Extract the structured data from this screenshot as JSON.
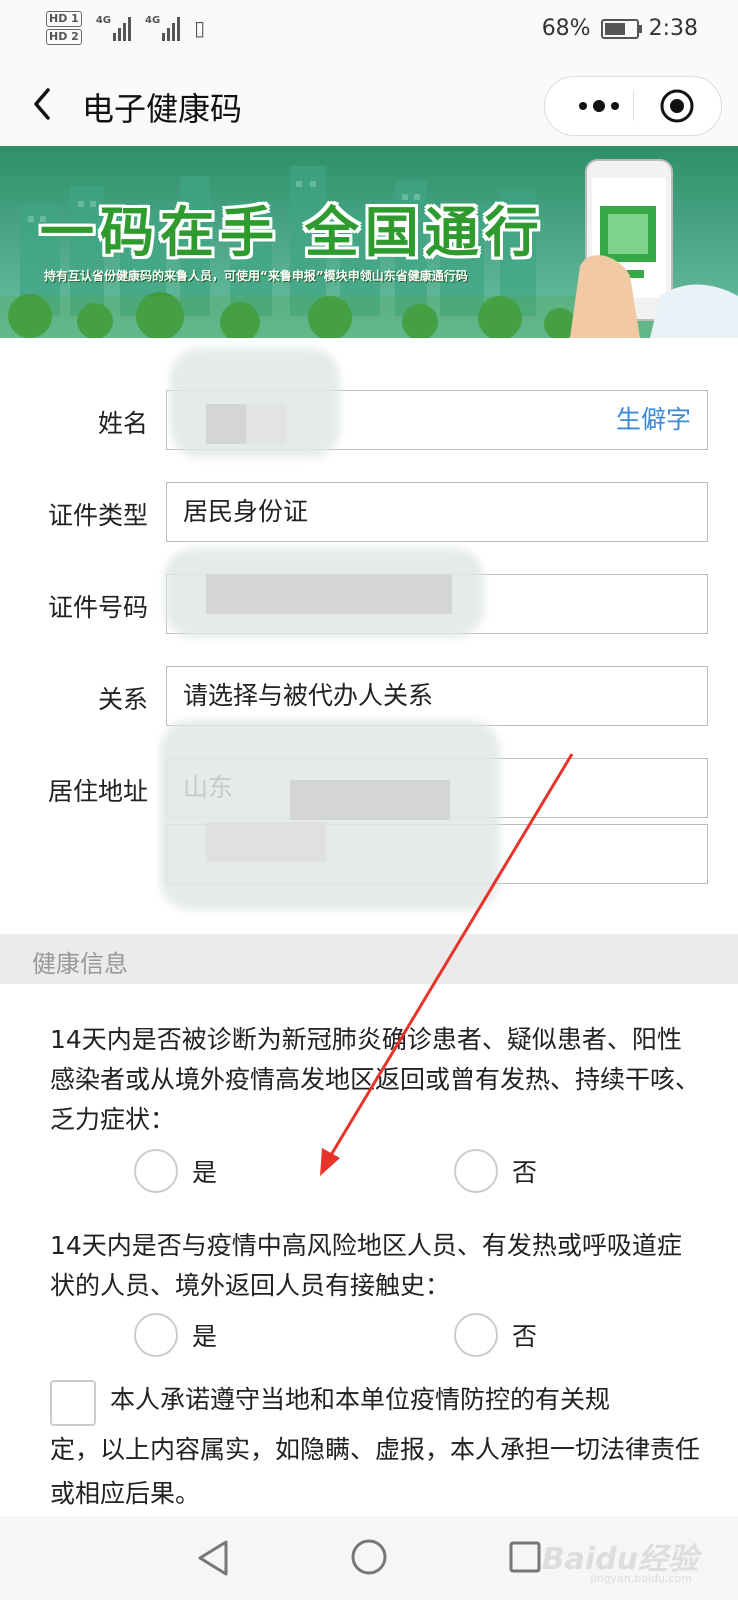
{
  "status_bar": {
    "hd1": "HD 1",
    "hd2": "HD 2",
    "net1": "4G",
    "net2": "4G",
    "battery": "68%",
    "time": "2:38",
    "battery_level": 0.68
  },
  "nav": {
    "title": "电子健康码"
  },
  "banner": {
    "slogan": "一码在手  全国通行",
    "subtitle": "持有互认省份健康码的来鲁人员，可使用“来鲁申报”模块申领山东省健康通行码"
  },
  "form": {
    "name_label": "姓名",
    "name_value": "",
    "rare_char_label": "生僻字",
    "id_type_label": "证件类型",
    "id_type_value": "居民身份证",
    "id_number_label": "证件号码",
    "id_number_value": "",
    "relation_label": "关系",
    "relation_placeholder": "请选择与被代办人关系",
    "address_label": "居住地址",
    "address_value": "山东",
    "address_detail_value": ""
  },
  "health": {
    "section_title": "健康信息",
    "q1": {
      "text": "14天内是否被诊断为新冠肺炎确诊患者、疑似患者、阳性感染者或从境外疫情高发地区返回或曾有发热、持续干咳、乏力症状：",
      "yes": "是",
      "no": "否"
    },
    "q2": {
      "text": "14天内是否与疫情中高风险地区人员、有发热或呼吸道症状的人员、境外返回人员有接触史：",
      "yes": "是",
      "no": "否"
    },
    "promise_line1": "本人承诺遵守当地和本单位疫情防控的有关规",
    "promise_rest": "定，以上内容属实，如隐瞒、虚报，本人承担一切法律责任或相应后果。"
  },
  "watermark": {
    "text": "Baidu经验",
    "sub": "jingyan.baidu.com"
  },
  "colors": {
    "accent_blue": "#3b8ad8",
    "banner_green": "#2f9a2e",
    "annotation_red": "#e8332a"
  },
  "icons": [
    "back-arrow-icon",
    "more-dots-icon",
    "close-target-icon",
    "nav-back-triangle-icon",
    "nav-home-circle-icon",
    "nav-recent-square-icon"
  ]
}
